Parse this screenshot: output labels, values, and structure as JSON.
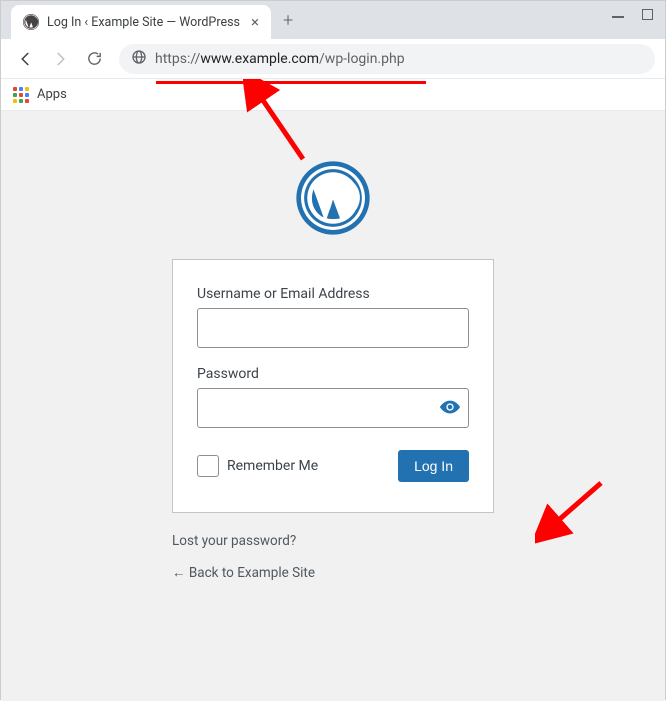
{
  "browser": {
    "tab_title": "Log In ‹ Example Site — WordPress",
    "new_tab_glyph": "+",
    "close_glyph": "×",
    "url": {
      "scheme": "https://",
      "host": "www.example.com",
      "path": "/wp-login.php"
    },
    "bookmarks": {
      "apps_label": "Apps"
    },
    "apps_colors": [
      "#ea4335",
      "#4285f4",
      "#fbbc05",
      "#34a853",
      "#ea4335",
      "#4285f4",
      "#fbbc05",
      "#34a853",
      "#ea4335"
    ]
  },
  "wp": {
    "logo_color": "#2271b1",
    "username_label": "Username or Email Address",
    "password_label": "Password",
    "remember_label": "Remember Me",
    "login_button": "Log In",
    "lost_password": "Lost your password?",
    "back_link": "← Back to Example Site"
  },
  "annotations": {
    "arrow_color": "#ff0000"
  }
}
